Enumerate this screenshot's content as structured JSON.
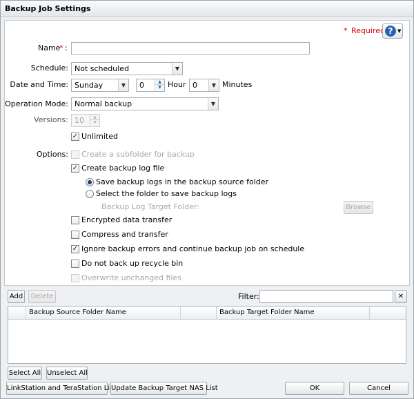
{
  "window": {
    "title": "Backup Job Settings"
  },
  "required": {
    "star": "*",
    "label": "Required"
  },
  "help": {
    "icon": "help-icon",
    "glyph": "?",
    "dropdown": "▼"
  },
  "form": {
    "name": {
      "label": "Name",
      "marker": "*",
      "colon": ":",
      "value": ""
    },
    "schedule": {
      "label": "Schedule:",
      "value": "Not scheduled"
    },
    "datetime": {
      "label": "Date and Time:",
      "day": "Sunday",
      "hour_value": "0",
      "hour_label": "Hour",
      "minute_value": "0",
      "minute_label": "Minutes"
    },
    "operation_mode": {
      "label": "Operation Mode:",
      "value": "Normal backup"
    },
    "versions": {
      "label": "Versions:",
      "value": "10"
    },
    "unlimited": {
      "label": "Unlimited",
      "checked": true
    },
    "options": {
      "label": "Options:",
      "create_subfolder": {
        "label": "Create a subfolder for backup",
        "checked": false,
        "disabled": true
      },
      "create_log": {
        "label": "Create backup log file",
        "checked": true
      },
      "save_in_source": {
        "label": "Save backup logs in the backup source folder",
        "selected": true
      },
      "select_folder": {
        "label": "Select the folder to save backup logs",
        "selected": false
      },
      "log_target_label": "Backup Log Target Folder:",
      "browse": "Browse",
      "encrypted": {
        "label": "Encrypted data transfer",
        "checked": false
      },
      "compress": {
        "label": "Compress and transfer",
        "checked": false
      },
      "ignore_errors": {
        "label": "Ignore backup errors and continue backup job on schedule",
        "checked": true
      },
      "no_recycle": {
        "label": "Do not back up recycle bin",
        "checked": false
      },
      "overwrite": {
        "label": "Overwrite unchanged files",
        "checked": false,
        "disabled": true
      }
    }
  },
  "folder_toolbar": {
    "add": "Add",
    "delete": "Delete",
    "filter_label": "Filter:",
    "filter_value": "",
    "clear": "✕"
  },
  "folder_table": {
    "columns": [
      "Backup Source Folder Name",
      "Backup Target Folder Name"
    ],
    "rows": []
  },
  "selection": {
    "select_all": "Select All",
    "unselect_all": "Unselect All"
  },
  "footer": {
    "linkstation_list": "LinkStation and TeraStation List",
    "update_list": "Update Backup Target NAS List",
    "ok": "OK",
    "cancel": "Cancel"
  },
  "check_glyph": "✓"
}
